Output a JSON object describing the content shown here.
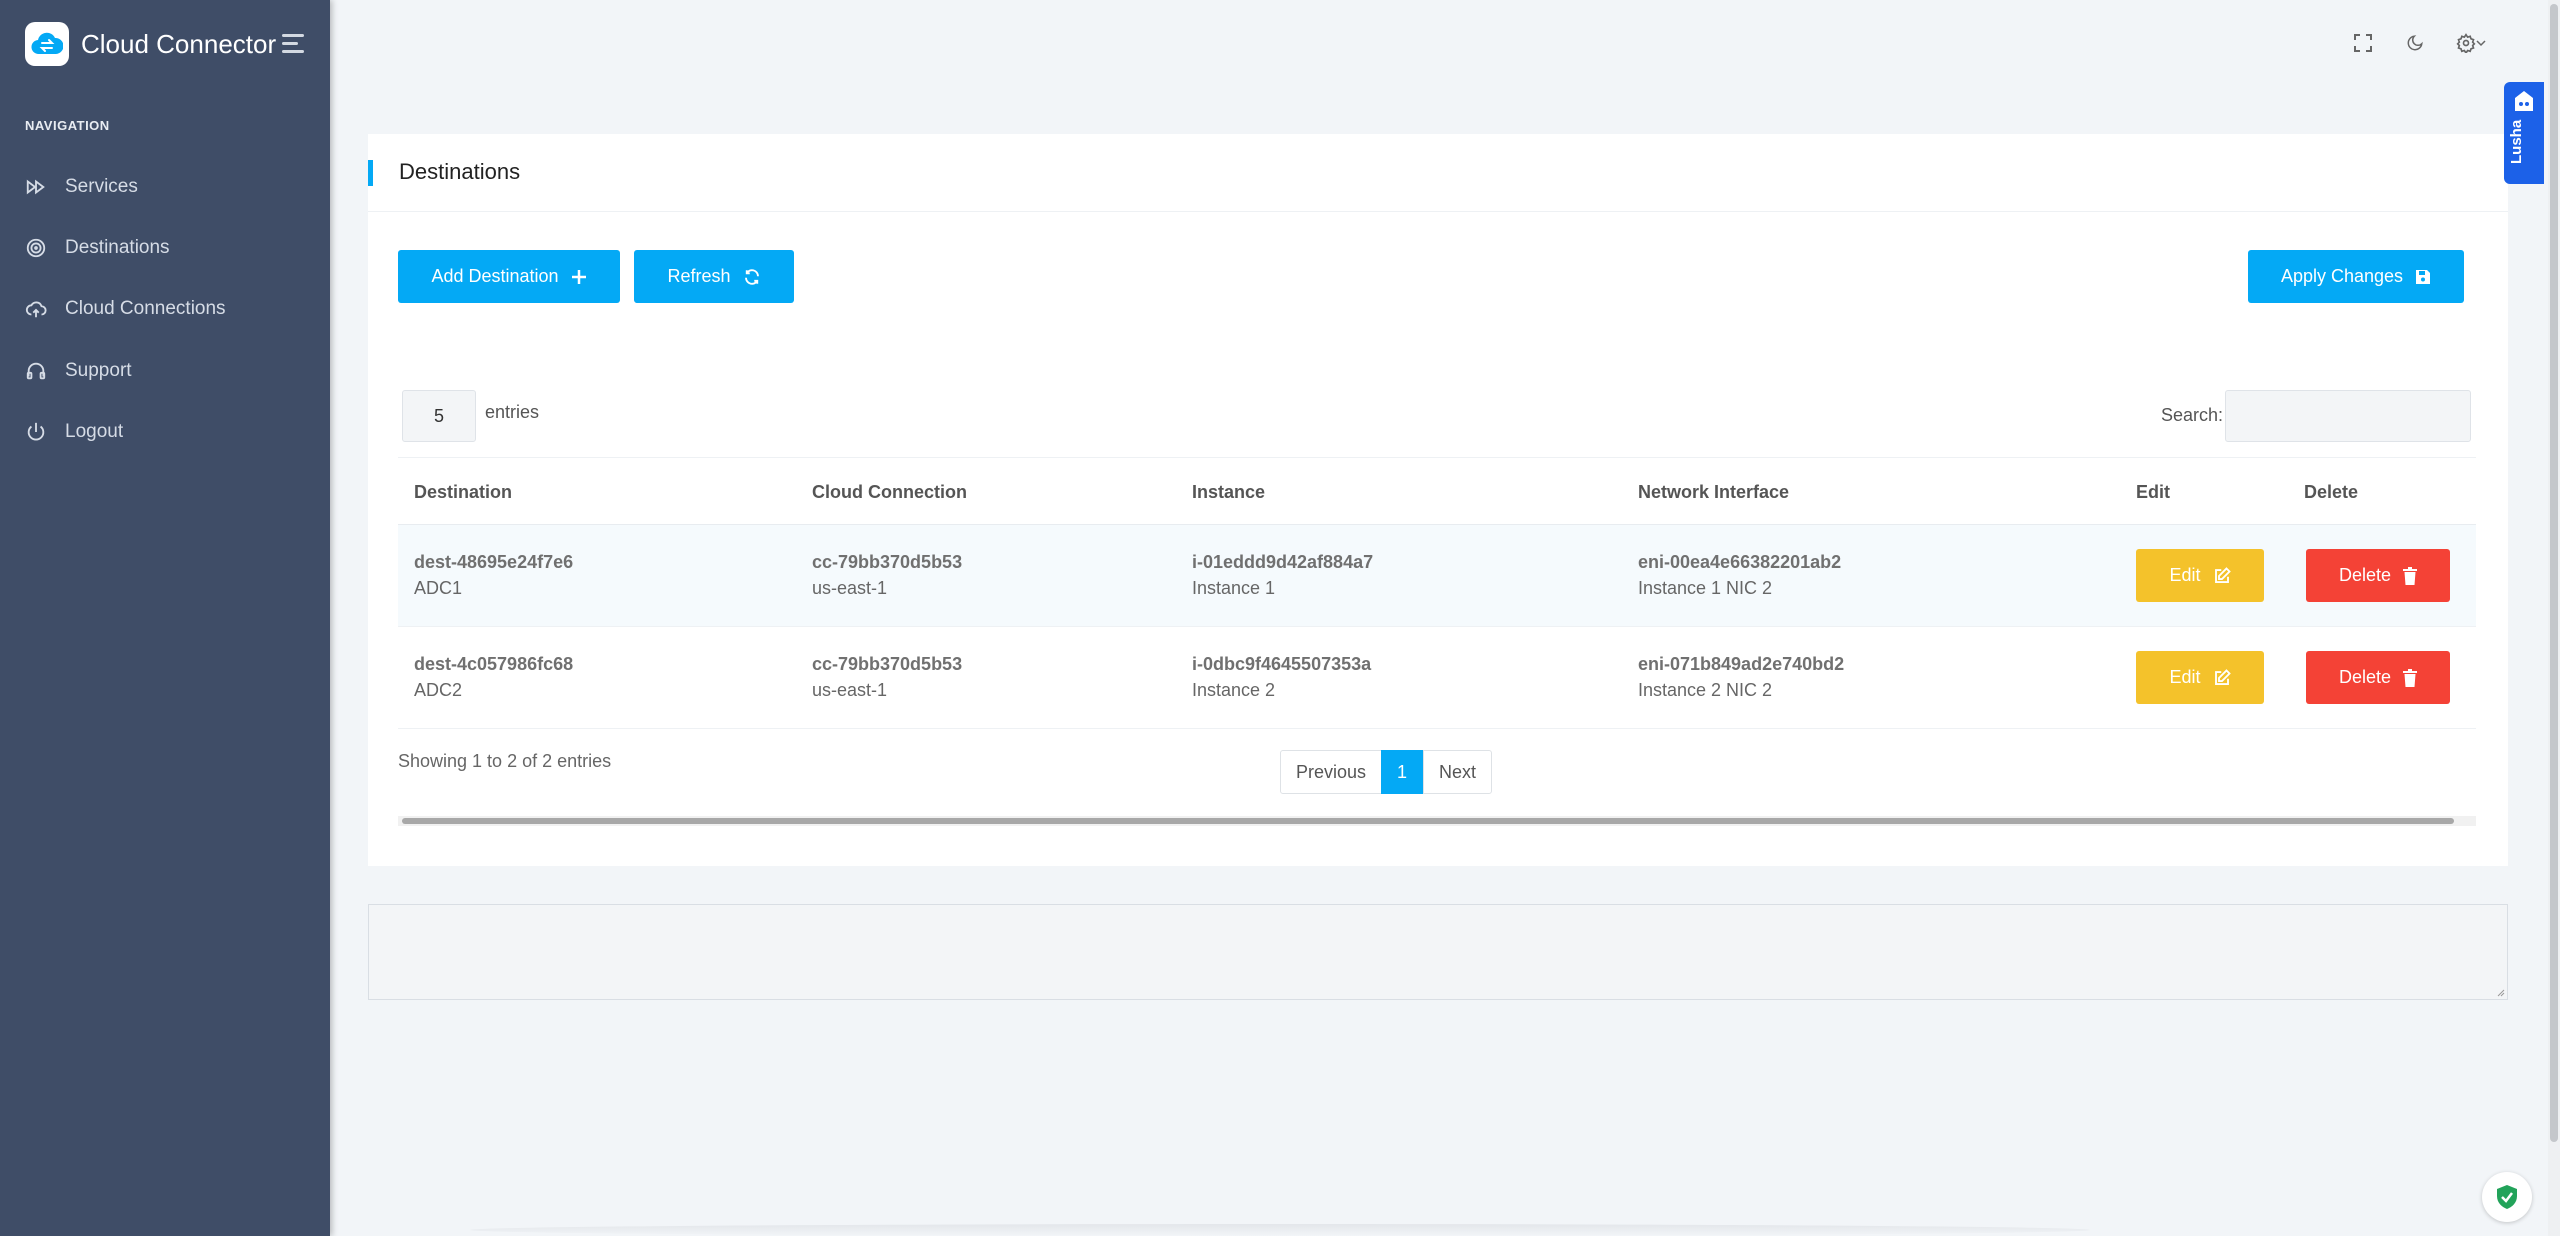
{
  "app": {
    "title": "Cloud Connector"
  },
  "nav": {
    "caption": "NAVIGATION",
    "items": [
      {
        "label": "Services",
        "icon": "fast-forward-icon"
      },
      {
        "label": "Destinations",
        "icon": "target-icon"
      },
      {
        "label": "Cloud Connections",
        "icon": "cloud-upload-icon"
      },
      {
        "label": "Support",
        "icon": "headphones-icon"
      },
      {
        "label": "Logout",
        "icon": "power-icon"
      }
    ]
  },
  "topbar": {
    "icons": [
      "fullscreen-icon",
      "moon-icon",
      "settings-icon"
    ]
  },
  "card": {
    "title": "Destinations",
    "buttons": {
      "add": "Add Destination",
      "refresh": "Refresh",
      "apply": "Apply Changes"
    },
    "length": {
      "value": "5",
      "label": "entries"
    },
    "search": {
      "label": "Search:",
      "value": ""
    }
  },
  "table": {
    "columns": [
      "Destination",
      "Cloud Connection",
      "Instance",
      "Network Interface",
      "Edit",
      "Delete"
    ],
    "rows": [
      {
        "destination_id": "dest-48695e24f7e6",
        "destination_name": "ADC1",
        "connection_id": "cc-79bb370d5b53",
        "connection_region": "us-east-1",
        "instance_id": "i-01eddd9d42af884a7",
        "instance_name": "Instance 1",
        "nic_id": "eni-00ea4e66382201ab2",
        "nic_name": "Instance 1 NIC 2",
        "edit": "Edit",
        "delete": "Delete"
      },
      {
        "destination_id": "dest-4c057986fc68",
        "destination_name": "ADC2",
        "connection_id": "cc-79bb370d5b53",
        "connection_region": "us-east-1",
        "instance_id": "i-0dbc9f4645507353a",
        "instance_name": "Instance 2",
        "nic_id": "eni-071b849ad2e740bd2",
        "nic_name": "Instance 2 NIC 2",
        "edit": "Edit",
        "delete": "Delete"
      }
    ],
    "info": "Showing 1 to 2 of 2 entries",
    "pagination": {
      "previous": "Previous",
      "current": "1",
      "next": "Next"
    }
  },
  "lusha": {
    "label": "Lusha"
  },
  "colors": {
    "accent": "#04a9f5",
    "sidebar": "#3f4d67",
    "warning": "#f4c22b",
    "danger": "#f44236"
  }
}
